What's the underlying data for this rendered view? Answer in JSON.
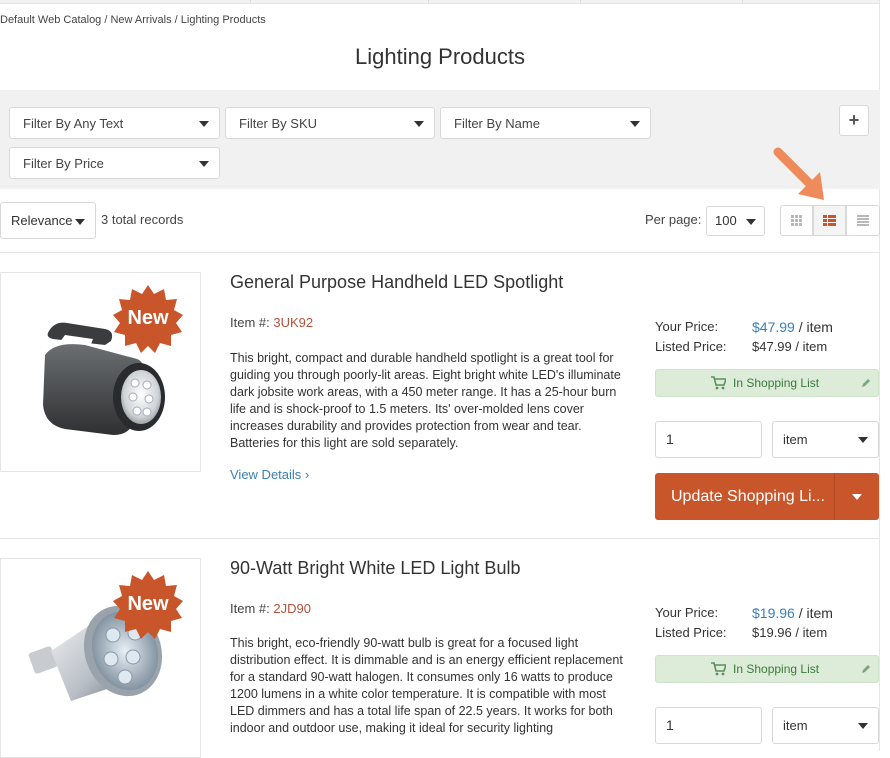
{
  "breadcrumb": "Default Web Catalog / New Arrivals / Lighting Products",
  "page_title": "Lighting Products",
  "filters": [
    {
      "label": "Filter By Any Text"
    },
    {
      "label": "Filter By SKU"
    },
    {
      "label": "Filter By Name"
    },
    {
      "label": "Filter By Price"
    }
  ],
  "add_filter_label": "+",
  "toolbar": {
    "sort_label": "Relevance",
    "records_text": "3 total records",
    "per_page_label": "Per page:",
    "per_page_value": "100",
    "views": [
      "grid-view-icon",
      "list-view-icon",
      "compact-view-icon"
    ],
    "active_view": "list-view-icon"
  },
  "products": [
    {
      "badge": "New",
      "title": "General Purpose Handheld LED Spotlight",
      "item_label": "Item #:",
      "sku": "3UK92",
      "description": "This bright, compact and durable handheld spotlight is a great tool for guiding you through poorly-lit areas. Eight bright white LED's illuminate dark jobsite work areas, with a 450 meter range. It has a 25-hour burn life and is shock-proof to 1.5 meters. Its' over-molded lens cover increases durability and provides protection from wear and tear. Batteries for this light are sold separately.",
      "view_details": "View Details ›",
      "your_price_label": "Your Price:",
      "your_price": "$47.99",
      "your_price_unit": "/ item",
      "list_price_label": "Listed Price:",
      "list_price": "$47.99 / item",
      "in_list_label": "In Shopping List",
      "quantity": "1",
      "uom": "item",
      "update_label": "Update Shopping Li..."
    },
    {
      "badge": "New",
      "title": "90-Watt Bright White LED Light Bulb",
      "item_label": "Item #:",
      "sku": "2JD90",
      "description": "This bright, eco-friendly 90-watt bulb is great for a focused light distribution effect. It is dimmable and is an energy efficient replacement for a standard 90-watt halogen. It consumes only 16 watts to produce 1200 lumens in a white color temperature. It is compatible with most LED dimmers and has a total life span of 22.5 years. It works for both indoor and outdoor use, making it ideal for security lighting",
      "your_price_label": "Your Price:",
      "your_price": "$19.96",
      "your_price_unit": "/ item",
      "list_price_label": "Listed Price:",
      "list_price": "$19.96 / item",
      "in_list_label": "In Shopping List",
      "quantity": "1",
      "uom": "item"
    }
  ],
  "colors": {
    "accent": "#c9562b",
    "link": "#3a7fb6",
    "in_list_bg": "#dcecd9",
    "annotation_arrow": "#ef8a5a"
  }
}
